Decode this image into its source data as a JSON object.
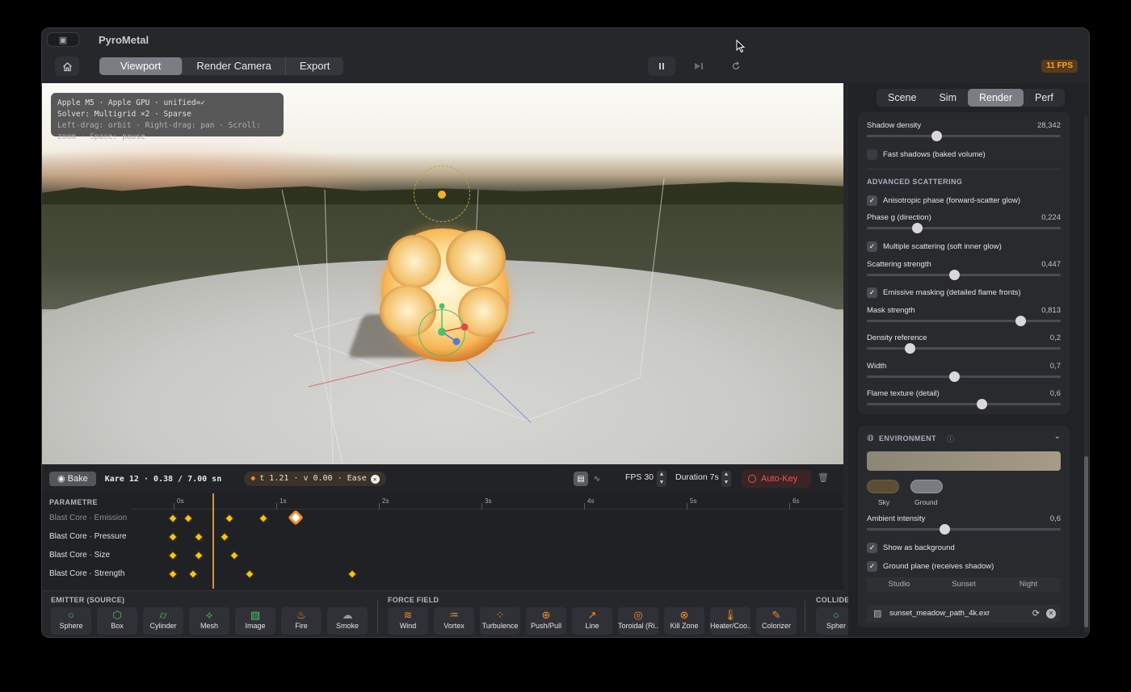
{
  "app": {
    "title": "PyroMetal",
    "fps_badge": "11 FPS"
  },
  "toolbar": {
    "tabs": [
      "Viewport",
      "Render Camera",
      "Export"
    ],
    "active_tab": "Viewport"
  },
  "hud": {
    "line1": "Apple M5 · Apple GPU · unified=✓",
    "line2": "Solver: Multigrid ×2 · Sparse",
    "line3": "Left-drag: orbit · Right-drag: pan · Scroll: zoom · Space: pause"
  },
  "timeline": {
    "bake_label": "Bake",
    "frame_info": "Kare 12 · 0.38 / 7.00 sn",
    "key_info": "t 1.21 · v 0.00 · Ease",
    "fps_label": "FPS 30",
    "duration_label": "Duration 7s",
    "autokey_label": "Auto-Key",
    "header": "PARAMETRE",
    "ruler": [
      "0s",
      "1s",
      "2s",
      "3s",
      "4s",
      "5s",
      "6s"
    ],
    "tracks": [
      {
        "label": "Blast Core · Emission",
        "keys_s": [
          0.0,
          0.15,
          0.55,
          0.88
        ],
        "selected_key_s": 1.21
      },
      {
        "label": "Blast Core · Pressure",
        "keys_s": [
          0.0,
          0.25,
          0.5
        ]
      },
      {
        "label": "Blast Core · Size",
        "keys_s": [
          0.0,
          0.25,
          0.6
        ]
      },
      {
        "label": "Blast Core · Strength",
        "keys_s": [
          0.0,
          0.2,
          0.75,
          1.75
        ]
      }
    ],
    "playhead_s": 0.38
  },
  "palette": {
    "emitter_title": "EMITTER (SOURCE)",
    "emitters": [
      {
        "label": "Sphere",
        "icon": "sphere-icon"
      },
      {
        "label": "Box",
        "icon": "cube-icon"
      },
      {
        "label": "Cylinder",
        "icon": "cylinder-icon"
      },
      {
        "label": "Mesh",
        "icon": "mesh-icon"
      },
      {
        "label": "Image",
        "icon": "image-icon"
      },
      {
        "label": "Fire",
        "icon": "fire-icon"
      },
      {
        "label": "Smoke",
        "icon": "smoke-icon"
      }
    ],
    "force_title": "FORCE FIELD",
    "forces": [
      {
        "label": "Wind",
        "icon": "wind-icon"
      },
      {
        "label": "Vortex",
        "icon": "tornado-icon"
      },
      {
        "label": "Turbulence",
        "icon": "turbulence-icon"
      },
      {
        "label": "Push/Pull",
        "icon": "magnet-icon"
      },
      {
        "label": "Line",
        "icon": "arrow-icon"
      },
      {
        "label": "Toroidal (Ri...",
        "icon": "torus-icon"
      },
      {
        "label": "Kill Zone",
        "icon": "kill-zone-icon"
      },
      {
        "label": "Heater/Coo...",
        "icon": "thermometer-icon"
      },
      {
        "label": "Colorizer",
        "icon": "colorizer-icon"
      }
    ],
    "collider_title": "COLLIDE",
    "colliders": [
      {
        "label": "Spher",
        "icon": "sphere-icon"
      }
    ]
  },
  "panel": {
    "tabs": [
      "Scene",
      "Sim",
      "Render",
      "Perf"
    ],
    "active_tab": "Render",
    "shadow_density": {
      "label": "Shadow density",
      "value": "28,342",
      "fraction": 0.36
    },
    "fast_shadows": {
      "label": "Fast shadows (baked volume)",
      "checked": false
    },
    "adv_title": "ADVANCED SCATTERING",
    "anisotropic": {
      "label": "Anisotropic phase (forward-scatter glow)",
      "checked": true
    },
    "phase_g": {
      "label": "Phase g (direction)",
      "value": "0,224",
      "fraction": 0.26
    },
    "multiple": {
      "label": "Multiple scattering (soft inner glow)",
      "checked": true
    },
    "scatter_strength": {
      "label": "Scattering strength",
      "value": "0,447",
      "fraction": 0.45
    },
    "emissive_mask": {
      "label": "Emissive masking (detailed flame fronts)",
      "checked": true
    },
    "mask_strength": {
      "label": "Mask strength",
      "value": "0,813",
      "fraction": 0.79
    },
    "density_ref": {
      "label": "Density reference",
      "value": "0,2",
      "fraction": 0.22
    },
    "width": {
      "label": "Width",
      "value": "0,7",
      "fraction": 0.45
    },
    "flame_texture": {
      "label": "Flame texture (detail)",
      "value": "0,6",
      "fraction": 0.59
    },
    "env_title": "ENVIRONMENT",
    "sky_label": "Sky",
    "ground_label": "Ground",
    "ambient": {
      "label": "Ambient intensity",
      "value": "0,6",
      "fraction": 0.4
    },
    "show_bg": {
      "label": "Show as background",
      "checked": true
    },
    "ground_plane": {
      "label": "Ground plane (receives shadow)",
      "checked": true
    },
    "presets": [
      "Studio",
      "Sunset",
      "Night"
    ],
    "hdr_file": "sunset_meadow_path_4k.exr",
    "colors": {
      "sky": "#5a4f36",
      "ground": "#7a7b80"
    }
  }
}
